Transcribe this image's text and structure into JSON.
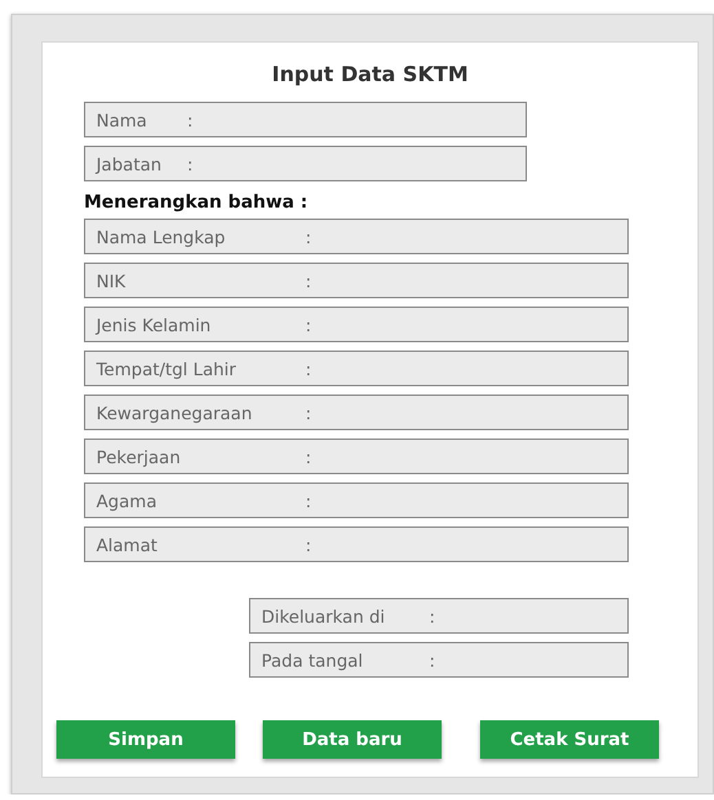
{
  "title": "Input Data SKTM",
  "signer_fields": [
    {
      "label": "Nama",
      "separator": ":"
    },
    {
      "label": "Jabatan",
      "separator": ":"
    }
  ],
  "section_label": "Menerangkan bahwa :",
  "person_fields": [
    {
      "label": "Nama Lengkap",
      "separator": ":"
    },
    {
      "label": "NIK",
      "separator": ":"
    },
    {
      "label": "Jenis Kelamin",
      "separator": ":"
    },
    {
      "label": "Tempat/tgl Lahir",
      "separator": ":"
    },
    {
      "label": "Kewarganegaraan",
      "separator": ":"
    },
    {
      "label": "Pekerjaan",
      "separator": ":"
    },
    {
      "label": "Agama",
      "separator": ":"
    },
    {
      "label": "Alamat",
      "separator": ":"
    }
  ],
  "issue_fields": [
    {
      "label": "Dikeluarkan di",
      "separator": ":"
    },
    {
      "label": "Pada tangal",
      "separator": ":"
    }
  ],
  "buttons": [
    "Simpan",
    "Data baru",
    "Cetak Surat"
  ]
}
